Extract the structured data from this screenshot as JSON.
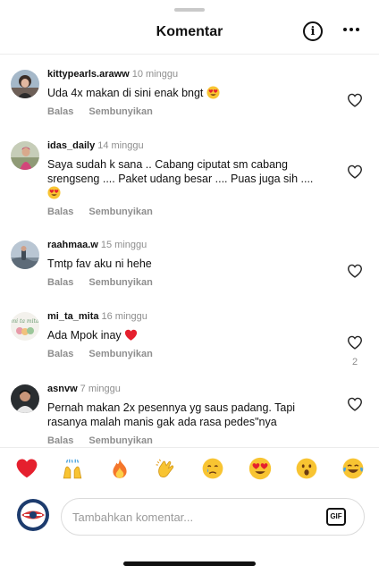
{
  "header": {
    "title": "Komentar",
    "info_icon": "info-circle-icon",
    "more_icon": "more-horizontal-icon"
  },
  "comments": [
    {
      "username": "kittypearls.araww",
      "time": "10 minggu",
      "text": "Uda 4x makan di sini enak bngt",
      "emoji": "heart-eyes",
      "reply_label": "Balas",
      "hide_label": "Sembunyikan",
      "likes": ""
    },
    {
      "username": "idas_daily",
      "time": "14 minggu",
      "text": "Saya sudah k sana .. Cabang ciputat sm cabang srengseng .... Paket udang besar .... Puas juga sih ....",
      "emoji": "heart-eyes",
      "reply_label": "Balas",
      "hide_label": "Sembunyikan",
      "likes": ""
    },
    {
      "username": "raahmaa.w",
      "time": "15 minggu",
      "text": "Tmtp fav aku ni hehe",
      "emoji": "",
      "reply_label": "Balas",
      "hide_label": "Sembunyikan",
      "likes": ""
    },
    {
      "username": "mi_ta_mita",
      "time": "16 minggu",
      "text": "Ada Mpok inay",
      "emoji": "red-heart",
      "reply_label": "Balas",
      "hide_label": "Sembunyikan",
      "likes": "2"
    },
    {
      "username": "asnvw",
      "time": "7 minggu",
      "text": "Pernah makan 2x pesennya yg saus padang. Tapi rasanya malah manis gak ada rasa pedes\"nya",
      "emoji": "",
      "reply_label": "Balas",
      "hide_label": "Sembunyikan",
      "likes": ""
    }
  ],
  "reactions": [
    {
      "icon": "red-heart",
      "glyph": "❤"
    },
    {
      "icon": "raising-hands",
      "glyph": "🙌"
    },
    {
      "icon": "fire",
      "glyph": "🔥"
    },
    {
      "icon": "clapping-hands",
      "glyph": "👏"
    },
    {
      "icon": "crying-face",
      "glyph": "😢"
    },
    {
      "icon": "heart-eyes",
      "glyph": "😍"
    },
    {
      "icon": "astonished-face",
      "glyph": "😮"
    },
    {
      "icon": "tears-of-joy",
      "glyph": "😂"
    }
  ],
  "composer": {
    "placeholder": "Tambahkan komentar...",
    "gif_label": "GIF"
  },
  "colors": {
    "text": "#111111",
    "secondary": "#8e8e8e",
    "divider": "#ececec",
    "heart_red": "#e5202e"
  }
}
